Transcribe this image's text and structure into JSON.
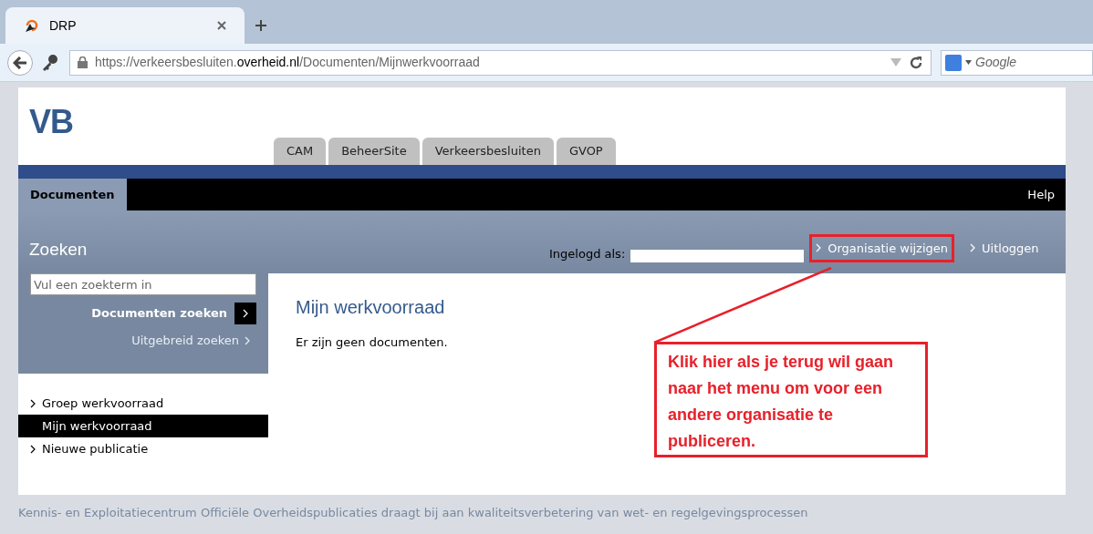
{
  "browser": {
    "tab_title": "DRP",
    "url": "https://verkeersbesluiten.**overheid.nl**/Documenten/Mijnwerkvoorraad",
    "search_placeholder": "Google"
  },
  "header": {
    "logo": "VB",
    "app_tabs": [
      {
        "label": "CAM",
        "selected": false
      },
      {
        "label": "BeheerSite",
        "selected": false
      },
      {
        "label": "Verkeersbesluiten",
        "selected": false
      },
      {
        "label": "GVOP",
        "selected": false
      }
    ]
  },
  "nav": {
    "items": [
      {
        "label": "Documenten",
        "selected": true
      }
    ],
    "help": "Help"
  },
  "search": {
    "title": "Zoeken",
    "placeholder": "Vul een zoekterm in",
    "button": "Documenten zoeken",
    "advanced": "Uitgebreid zoeken"
  },
  "user_bar": {
    "label": "Ingelogd als:",
    "links": [
      {
        "label": "Organisatie wijzigen",
        "highlighted": true
      },
      {
        "label": "Uitloggen",
        "highlighted": false
      }
    ]
  },
  "sidebar": {
    "items": [
      {
        "label": "Groep werkvoorraad",
        "selected": false
      },
      {
        "label": "Mijn werkvoorraad",
        "selected": true
      },
      {
        "label": "Nieuwe publicatie",
        "selected": false
      }
    ]
  },
  "content": {
    "title": "Mijn werkvoorraad",
    "message": "Er zijn geen documenten."
  },
  "annotation": {
    "text": "Klik hier als je terug wil gaan naar het menu om voor een andere organisatie te publiceren."
  },
  "footer": "Kennis- en Exploitatiecentrum Officiële Overheidspublicaties draagt bij aan kwaliteitsverbetering van wet- en regelgevingsprocessen"
}
